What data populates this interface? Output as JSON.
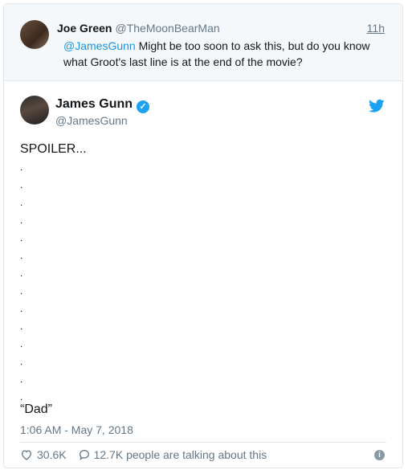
{
  "reply_tweet": {
    "name": "Joe Green",
    "handle": "@TheMoonBearMan",
    "time": "11h",
    "mention": "@JamesGunn",
    "text": " Might be too soon to ask this, but do you know what Groot's last line is at the end of the movie?"
  },
  "tweet": {
    "name": "James Gunn",
    "handle": "@JamesGunn",
    "verified_icon": "verified-badge-icon",
    "opening": "SPOILER...",
    "dots": [
      ".",
      ".",
      ".",
      ".",
      ".",
      ".",
      ".",
      ".",
      ".",
      ".",
      ".",
      ".",
      ".",
      "."
    ],
    "final_line": "“Dad”",
    "timestamp": "1:06 AM - May 7, 2018"
  },
  "actions": {
    "likes": "30.6K",
    "talking": "12.7K people are talking about this",
    "icons": [
      "heart-icon",
      "comment-icon",
      "info-icon",
      "twitter-bird-icon"
    ]
  },
  "colors": {
    "accent": "#1da1f2",
    "link": "#1b95e0",
    "secondary_text": "#657786",
    "reply_bg": "#f5f8fa",
    "border": "#e1e8ed"
  }
}
